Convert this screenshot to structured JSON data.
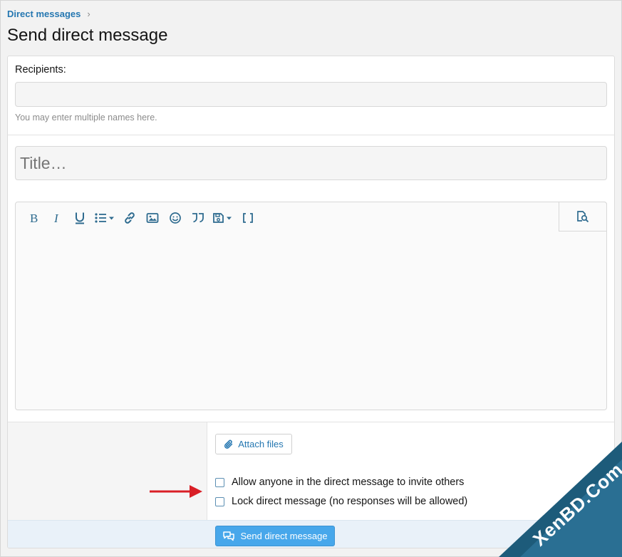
{
  "breadcrumb": {
    "label": "Direct messages",
    "separator": "›"
  },
  "page": {
    "title": "Send direct message"
  },
  "recipients": {
    "label": "Recipients:",
    "value": "",
    "hint": "You may enter multiple names here."
  },
  "title_field": {
    "placeholder": "Title…"
  },
  "editor": {
    "toolbar": [
      "bold-icon",
      "italic-icon",
      "underline-icon",
      "list-icon",
      "link-icon",
      "image-icon",
      "smiley-icon",
      "quote-icon",
      "drafts-icon",
      "brackets-icon"
    ],
    "preview": "preview-icon",
    "content": ""
  },
  "attach": {
    "label": "Attach files"
  },
  "options": {
    "allow_invite": {
      "label": "Allow anyone in the direct message to invite others",
      "checked": false
    },
    "lock": {
      "label": "Lock direct message (no responses will be allowed)",
      "checked": false
    }
  },
  "submit": {
    "label": "Send direct message"
  },
  "watermark": {
    "text": "XenBD.Com"
  },
  "colors": {
    "link": "#2577b1",
    "button": "#47a7eb",
    "footer": "#e9f1f9",
    "arrow": "#d91f26",
    "watermark": "#1d5b7a"
  }
}
